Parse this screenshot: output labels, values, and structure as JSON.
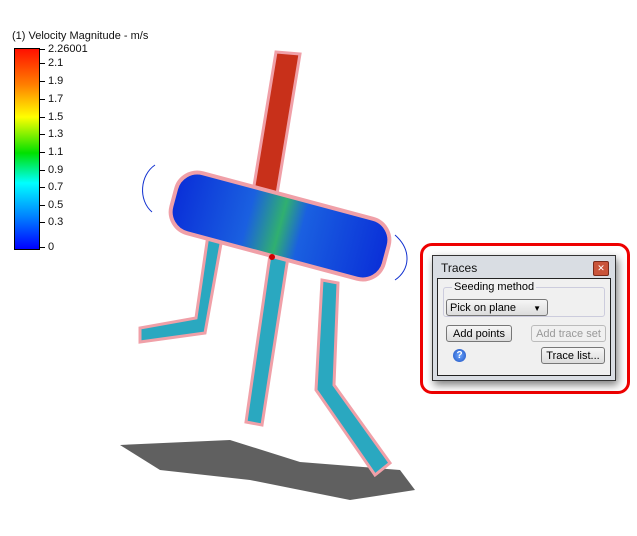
{
  "legend": {
    "title": "(1) Velocity Magnitude - m/s",
    "ticks": [
      "2.26001",
      "2.1",
      "1.9",
      "1.7",
      "1.5",
      "1.3",
      "1.1",
      "0.9",
      "0.7",
      "0.5",
      "0.3",
      "0"
    ]
  },
  "dialog": {
    "title": "Traces",
    "close_icon": "close-icon",
    "group_label": "Seeding method",
    "seeding_value": "Pick on plane",
    "add_points": "Add points",
    "add_trace_set": "Add trace set",
    "help_icon": "help-icon",
    "trace_list": "Trace list...",
    "highlight_color": "#e00000"
  }
}
